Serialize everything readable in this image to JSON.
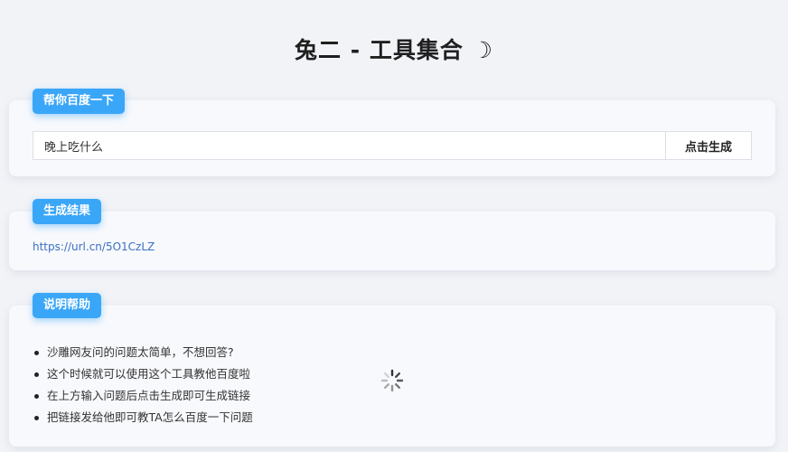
{
  "header": {
    "title": "兔二 - 工具集合",
    "icon": "crescent-moon-icon",
    "icon_glyph": "☽"
  },
  "search_card": {
    "tag_label": "帮你百度一下",
    "input_value": "晚上吃什么",
    "button_label": "点击生成"
  },
  "result_card": {
    "tag_label": "生成结果",
    "link_text": "https://url.cn/5O1CzLZ"
  },
  "help_card": {
    "tag_label": "说明帮助",
    "items": [
      "沙雕网友问的问题太简单，不想回答?",
      "这个时候就可以使用这个工具教他百度啦",
      "在上方输入问题后点击生成即可生成链接",
      "把链接发给他即可教TA怎么百度一下问题"
    ]
  },
  "colors": {
    "accent": "#3aa6f8",
    "link": "#3a6fc4",
    "background": "#f1f3f7"
  },
  "loading_indicator": "spinner-icon"
}
